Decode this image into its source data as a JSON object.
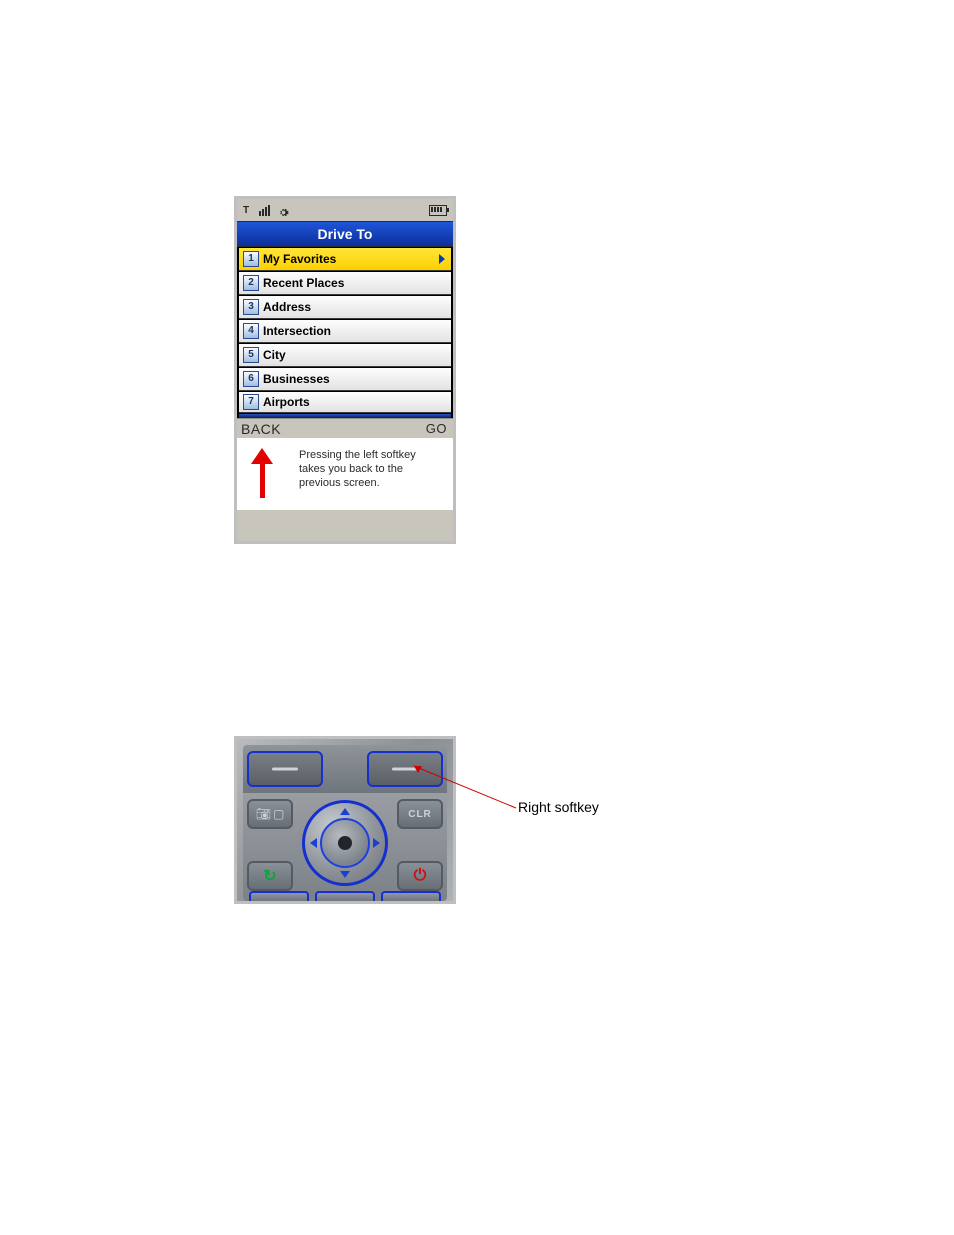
{
  "figure1": {
    "status": {
      "signal_icon": "signal-icon",
      "settings_icon": "gear-icon",
      "battery_icon": "battery-icon"
    },
    "title": "Drive To",
    "menu": [
      {
        "num": "1",
        "label": "My Favorites",
        "selected": true
      },
      {
        "num": "2",
        "label": "Recent Places",
        "selected": false
      },
      {
        "num": "3",
        "label": "Address",
        "selected": false
      },
      {
        "num": "4",
        "label": "Intersection",
        "selected": false
      },
      {
        "num": "5",
        "label": "City",
        "selected": false
      },
      {
        "num": "6",
        "label": "Businesses",
        "selected": false
      },
      {
        "num": "7",
        "label": "Airports",
        "selected": false
      }
    ],
    "softkeys": {
      "left": "BACK",
      "right": "GO"
    },
    "tip": "Pressing the left softkey takes you back to the previous screen."
  },
  "figure2": {
    "keys": {
      "left_softkey": "left-softkey",
      "right_softkey": "right-softkey",
      "camera": "camera-key",
      "clr_label": "CLR",
      "dpad": "navigation-dpad",
      "send": "send-key",
      "end": "end-key"
    },
    "callout": "Right softkey"
  }
}
